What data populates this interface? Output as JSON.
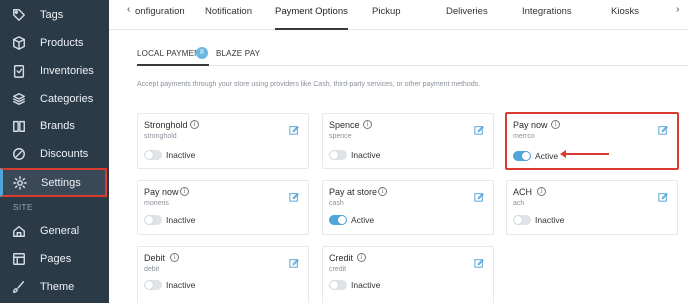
{
  "sidebar": {
    "items": [
      {
        "label": "Tags",
        "icon": "tag-icon"
      },
      {
        "label": "Products",
        "icon": "box-icon"
      },
      {
        "label": "Inventories",
        "icon": "clipboard-icon"
      },
      {
        "label": "Categories",
        "icon": "layers-icon"
      },
      {
        "label": "Brands",
        "icon": "book-icon"
      },
      {
        "label": "Discounts",
        "icon": "discount-icon"
      },
      {
        "label": "Settings",
        "icon": "gear-icon",
        "active": true
      }
    ],
    "section_label": "SITE",
    "site_items": [
      {
        "label": "General",
        "icon": "home-icon"
      },
      {
        "label": "Pages",
        "icon": "pages-icon"
      },
      {
        "label": "Theme",
        "icon": "brush-icon"
      }
    ]
  },
  "tabs": {
    "items": [
      "onfiguration",
      "Notification",
      "Payment Options",
      "Pickup",
      "Deliveries",
      "Integrations",
      "Kiosks"
    ],
    "active": "Payment Options"
  },
  "subtabs": {
    "local_payment": "LOCAL PAYMENT",
    "badge": "8",
    "blaze_pay": "BLAZE PAY"
  },
  "description": "Accept payments through your store using providers like Cash, third-party services, or other payment methods.",
  "cards": [
    {
      "title": "Stronghold",
      "sub": "stronghold",
      "status": "Inactive",
      "on": false
    },
    {
      "title": "Spence",
      "sub": "spence",
      "status": "Inactive",
      "on": false
    },
    {
      "title": "Pay now",
      "sub": "merrco",
      "status": "Active",
      "on": true,
      "highlight": true
    },
    {
      "title": "Pay now",
      "sub": "moneris",
      "status": "Inactive",
      "on": false
    },
    {
      "title": "Pay at store",
      "sub": "cash",
      "status": "Active",
      "on": true
    },
    {
      "title": "ACH",
      "sub": "ach",
      "status": "Inactive",
      "on": false
    },
    {
      "title": "Debit",
      "sub": "debit",
      "status": "Inactive",
      "on": false
    },
    {
      "title": "Credit",
      "sub": "credit",
      "status": "Inactive",
      "on": false
    }
  ],
  "colors": {
    "sidebar_bg": "#2b3a47",
    "accent": "#4fa6d8",
    "highlight": "#d93d30"
  }
}
